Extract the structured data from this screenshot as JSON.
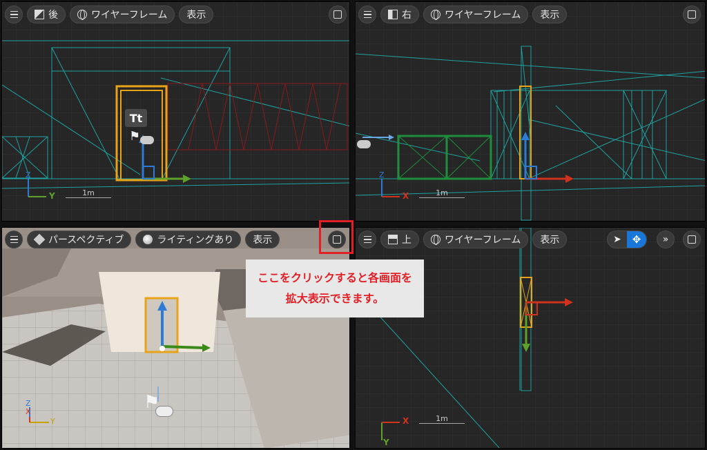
{
  "viewports": {
    "back": {
      "menu": "menu",
      "view_label": "後",
      "mode_label": "ワイヤーフレーム",
      "show_label": "表示",
      "scale": "1m",
      "axes": [
        "Z",
        "Y"
      ]
    },
    "right": {
      "view_label": "右",
      "mode_label": "ワイヤーフレーム",
      "show_label": "表示",
      "scale": "1m",
      "axes": [
        "Z",
        "X"
      ]
    },
    "perspective": {
      "view_label": "パースペクティブ",
      "mode_label": "ライティングあり",
      "show_label": "表示",
      "axes": [
        "Z",
        "X",
        "Y"
      ]
    },
    "top": {
      "view_label": "上",
      "mode_label": "ワイヤーフレーム",
      "show_label": "表示",
      "scale": "1m",
      "axes": [
        "X",
        "Y"
      ]
    }
  },
  "annotation": {
    "line1": "ここをクリックすると各画面を",
    "line2": "拡大表示できます。"
  },
  "colors": {
    "accent_red": "#e21f26",
    "wire": "#1fa3a3",
    "gizmo_blue": "#2e7bd6",
    "gizmo_green": "#5fa12a",
    "gizmo_red": "#d0321e",
    "door_orange": "#e8a317"
  },
  "icons": [
    "menu-icon",
    "cube-view-icon",
    "globe-icon",
    "sun-icon",
    "maximize-icon",
    "select-arrow-icon",
    "move-icon",
    "chevron-double-right-icon",
    "flag-icon",
    "gamepad-icon",
    "text-icon"
  ]
}
